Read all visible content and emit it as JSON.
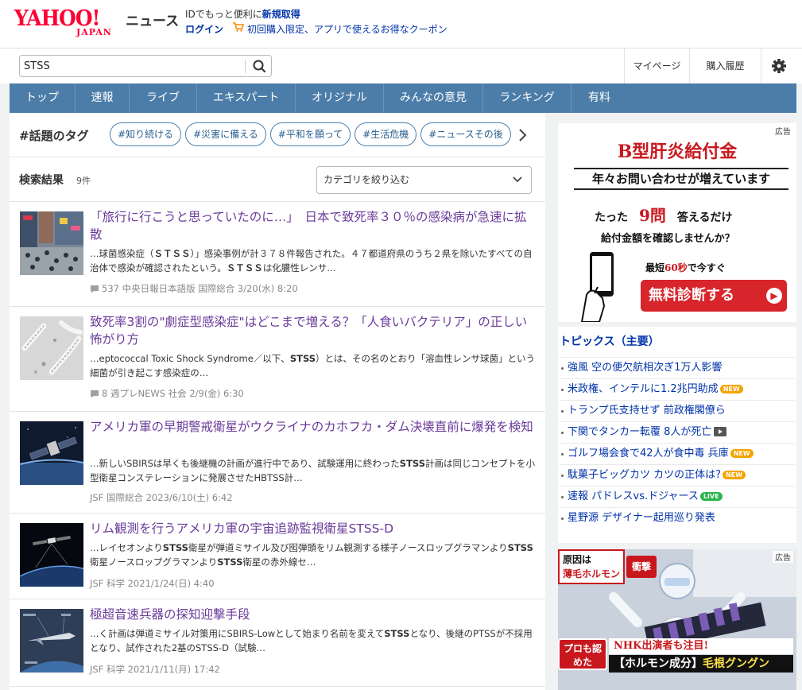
{
  "header": {
    "logo_text": "YAHOO!",
    "logo_sub": "JAPAN",
    "service": "ニュース",
    "promo_prefix": "IDでもっと便利に",
    "register_label": "新規取得",
    "login_label": "ログイン",
    "coupon_text": "初回購入限定、アプリで使えるお得なクーポン"
  },
  "search": {
    "value": "STSS",
    "mypage_label": "マイページ",
    "history_label": "購入履歴"
  },
  "nav": {
    "items": [
      "トップ",
      "速報",
      "ライブ",
      "エキスパート",
      "オリジナル",
      "みんなの意見",
      "ランキング",
      "有料"
    ]
  },
  "tags": {
    "title": "#話題のタグ",
    "items": [
      "#知り続ける",
      "#災害に備える",
      "#平和を願って",
      "#生活危機",
      "#ニュースその後"
    ]
  },
  "results": {
    "title": "検索結果",
    "count": "9件",
    "category_placeholder": "カテゴリを絞り込む"
  },
  "articles": [
    {
      "title": "「旅行に行こうと思っていたのに…」　日本で致死率３０％の感染病が急速に拡散",
      "snippet_pre": "…球菌感染症（",
      "snippet_bold1": "ＳＴＳＳ",
      "snippet_mid": "）」感染事例が計３７８件報告された。４７都道府県のうち２県を除いたすべての自治体で感染が確認されたという。",
      "snippet_bold2": "ＳＴＳＳ",
      "snippet_post": "は化膿性レンサ…",
      "comments": "537",
      "meta": "中央日報日本語版 国際総合 3/20(水) 8:20"
    },
    {
      "title": "致死率3割の\"劇症型感染症\"はどこまで増える？「人食いバクテリア」の正しい怖がり方",
      "snippet_pre": "…eptococcal Toxic Shock Syndrome／以下、",
      "snippet_bold1": "STSS",
      "snippet_post": "）とは、その名のとおり「溶血性レンサ球菌」という細菌が引き起こす感染症の…",
      "comments": "8",
      "meta": "週プレNEWS 社会 2/9(金) 6:30"
    },
    {
      "title": "アメリカ軍の早期警戒衛星がウクライナのカホフカ・ダム決壊直前に爆発を検知",
      "snippet_pre": "…新しいSBIRSは早くも後継機の計画が進行中であり、試験運用に終わった",
      "snippet_bold1": "STSS",
      "snippet_post": "計画は同じコンセプトを小型衛星コンステレーションに発展させたHBTSS計…",
      "meta": "JSF 国際総合 2023/6/10(土) 6:42"
    },
    {
      "title": "リム観測を行うアメリカ軍の宇宙追跡監視衛星STSS-D",
      "snippet_pre": "…レイセオンより",
      "snippet_bold1": "STSS",
      "snippet_mid": "衛星が弾道ミサイル及び囮弾頭をリム観測する様子ノースロップグラマンより",
      "snippet_bold2": "STSS",
      "snippet_mid2": "衛星ノースロップグラマンより",
      "snippet_bold3": "STSS",
      "snippet_post": "衛星の赤外線セ…",
      "meta": "JSF 科学 2021/1/24(日) 4:40"
    },
    {
      "title": "極超音速兵器の探知迎撃手段",
      "snippet_pre": "…く計画は弾道ミサイル対策用にSBIRS-Lowとして始まり名前を変えて",
      "snippet_bold1": "STSS",
      "snippet_post": "となり、後継のPTSSが不採用となり、試作された2基のSTSS-D（試験…",
      "meta": "JSF 科学 2021/1/11(月) 17:42"
    }
  ],
  "ad1": {
    "label": "広告",
    "headline": "B型肝炎給付金",
    "sub": "年々お問い合わせが増えています",
    "line1_pre": "たった",
    "line1_q": "9問",
    "line1_post": "答えるだけ",
    "line2": "給付金額を確認しませんか？",
    "line3_pre": "最短",
    "line3_red": "60秒",
    "line3_post": "で今すぐ",
    "cta": "無料診断する"
  },
  "topics": {
    "title": "トピックス（主要）",
    "items": [
      {
        "text": "強風 空の便欠航相次ぎ1万人影響",
        "badge": ""
      },
      {
        "text": "米政権、インテルに1.2兆円助成",
        "badge": "NEW"
      },
      {
        "text": "トランプ氏支持せず 前政権閣僚ら",
        "badge": ""
      },
      {
        "text": "下関でタンカー転覆 8人が死亡",
        "badge": "VIDEO"
      },
      {
        "text": "ゴルフ場会食で42人が食中毒 兵庫",
        "badge": "NEW"
      },
      {
        "text": "駄菓子ビッグカツ カツの正体は?",
        "badge": "NEW"
      },
      {
        "text": "速報 パドレスvs.ドジャース",
        "badge": "LIVE"
      },
      {
        "text": "星野源 デザイナー起用巡り発表",
        "badge": ""
      }
    ]
  },
  "ad2": {
    "label": "広告",
    "tag1_a": "原因は",
    "tag1_b": "薄毛ホルモン",
    "tag2": "衝撃",
    "bottom1": "プロも認めた",
    "bottom2": "NHK出演者も注目!",
    "bottom3_a": "【ホルモン成分】",
    "bottom3_b": "毛根グングン"
  },
  "colors": {
    "brand_red": "#ff0033",
    "nav_blue": "#4c7da8",
    "link_blue": "#0033aa",
    "visited_purple": "#6a3a9a"
  }
}
